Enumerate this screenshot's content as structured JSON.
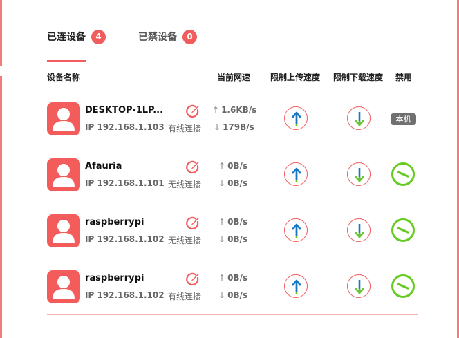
{
  "tabs": {
    "connected": {
      "label": "已连设备",
      "count": "4"
    },
    "blocked": {
      "label": "已禁设备",
      "count": "0"
    }
  },
  "table_headers": {
    "device_name": "设备名称",
    "current_speed": "当前网速",
    "limit_upload": "限制上传速度",
    "limit_download": "限制下载速度",
    "block": "禁用"
  },
  "devices": [
    {
      "name": "DESKTOP-1LP...",
      "ip": "IP 192.168.1.103",
      "connection": "有线连接",
      "up_speed": "1.6KB/s",
      "down_speed": "179B/s",
      "badge": "本机"
    },
    {
      "name": "Afauria",
      "ip": "IP 192.168.1.101",
      "connection": "无线连接",
      "up_speed": "0B/s",
      "down_speed": "0B/s"
    },
    {
      "name": "raspberrypi",
      "ip": "IP 192.168.1.102",
      "connection": "无线连接",
      "up_speed": "0B/s",
      "down_speed": "0B/s"
    },
    {
      "name": "raspberrypi",
      "ip": "IP 192.168.1.102",
      "connection": "有线连接",
      "up_speed": "0B/s",
      "down_speed": "0B/s"
    }
  ],
  "colors": {
    "accent": "#f25c5c",
    "arrow_blue": "#1a78c2",
    "arrow_green": "#6cc62a",
    "ban_green": "#66cc22",
    "host_badge": "#707070"
  },
  "icons": {
    "avatar": "user-avatar-icon",
    "edit": "edit-pencil-icon",
    "upload_limit": "upload-arrow-icon",
    "download_limit": "download-arrow-icon",
    "block": "block-icon"
  }
}
